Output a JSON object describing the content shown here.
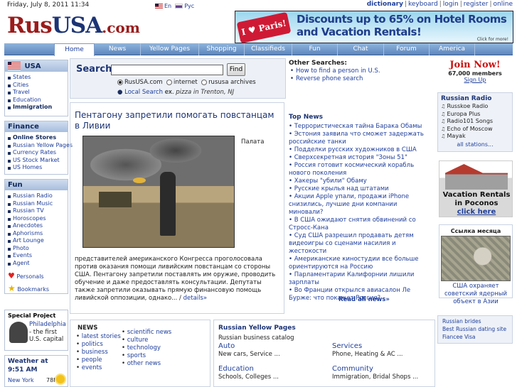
{
  "header": {
    "date": "Friday, July 8, 2011 11:34",
    "lang_en": "En",
    "lang_ru": "Рус",
    "links": [
      "dictionary",
      "keyboard",
      "login",
      "register",
      "online"
    ]
  },
  "logo": {
    "rus": "Rus",
    "usa": "USA",
    "com": ".com"
  },
  "banner": {
    "badge": "I ♥ Paris!",
    "text": "Discounts up to 65% on Hotel Rooms and Vacation Rentals!",
    "sub": "Click for more!"
  },
  "nav": {
    "tabs": [
      "Home",
      "News",
      "Yellow Pages",
      "Shopping",
      "Classifieds",
      "Fun",
      "Chat",
      "Forum",
      "America"
    ]
  },
  "sidebar": {
    "usa_title": "USA",
    "usa_items": [
      "States",
      "Cities",
      "Travel",
      "Education",
      "Immigration"
    ],
    "finance_title": "Finance",
    "finance_items": [
      "Online Stores",
      "Russian Yellow Pages",
      "Currency Rates",
      "US Stock Market",
      "US Homes"
    ],
    "fun_title": "Fun",
    "fun_items": [
      "Russian Radio",
      "Russian Music",
      "Russian TV",
      "Horoscopes",
      "Anecdotes",
      "Aphorisms",
      "Art Lounge",
      "Photo",
      "Events",
      "Agent"
    ],
    "personals": "Personals",
    "bookmarks": "Bookmarks"
  },
  "search": {
    "label": "Search:",
    "button": "Find",
    "value": "",
    "options": [
      "RusUSA.com",
      "internet",
      "rususa archives"
    ],
    "local_link": "Local Search",
    "local_ex": "ex.",
    "local_example": "pizza in Trenton, NJ"
  },
  "other_searches": {
    "title": "Other Searches:",
    "items": [
      "How to find a person in U.S.",
      "Reverse phone search"
    ]
  },
  "article": {
    "title": "Пентагону запретили помогать повстанцам в Ливии",
    "side_word": "Палата",
    "body": "представителей американского Конгресса проголосовала против оказания помощи ливийским повстанцам со стороны США. Пентагону запретили поставлять им оружие, проводить обучение и даже предоставлять консультации. Депутаты также запретили оказывать прямую финансовую помощь ливийской оппозиции, однако... /",
    "details": "details»"
  },
  "top_news": {
    "title": "Top News",
    "items": [
      "Террористическая тайна Барака Обамы",
      "Эстония заявила что сможет задержать российские танки",
      "Подделки русских художников в США",
      "Сверхсекретная история \"Зоны 51\"",
      "Россия готовит космический корабль нового поколения",
      "Хакеры \"убили\" Обаму",
      "Русские крылья над штатами",
      "Акции Apple упали, продажи iPhone снизились, лучшие дни компании миновали?",
      "В США ожидают снятия обвинений со Стросс-Кана",
      "Суд США разрешил продавать детям видеоигры со сценами насилия и жестокости",
      "Американские киностудии все больше ориентируются на Россию",
      "Парламентарии Калифорнии лишили зарплаты",
      "Во Франции открылся авиасалон Ле Бурже: что покажет Россия?"
    ],
    "read_all": "Read all news»"
  },
  "join": {
    "title": "Join Now!",
    "members": "67,000 members",
    "signup": "Sign Up"
  },
  "radio": {
    "title": "Russian Radio",
    "stations": [
      "Russkoe Radio",
      "Europa Plus",
      "Radio101 Songs",
      "Echo of Moscow",
      "Mayak"
    ],
    "all": "all stations..."
  },
  "vacation": {
    "line1": "Vacation Rentals in Poconos",
    "link": "click here"
  },
  "month": {
    "title": "Ссылка месяца",
    "caption": "США охраняет советский ядерный объект в Азии"
  },
  "brides": [
    "Russian brides",
    "Best Russian dating site",
    "Fiancee Visa"
  ],
  "special": {
    "title": "Special Project",
    "link": "Philadelphia",
    "text1": "- the first",
    "text2": "U.S. capital"
  },
  "weather": {
    "title": "Weather at 9:51 AM",
    "city": "New York",
    "temp": "78F"
  },
  "news_block": {
    "title": "NEWS",
    "col1": [
      "latest stories",
      "politics",
      "business",
      "people",
      "events"
    ],
    "col2": [
      "scientific news",
      "culture",
      "technology",
      "sports",
      "other news"
    ]
  },
  "yellow_pages": {
    "title": "Russian Yellow Pages",
    "subtitle": "Russian business catalog",
    "cats": [
      {
        "name": "Auto",
        "desc": "New cars, Service ..."
      },
      {
        "name": "Services",
        "desc": "Phone, Heating & AC ..."
      },
      {
        "name": "Education",
        "desc": "Schools, Colleges ..."
      },
      {
        "name": "Community",
        "desc": "Immigration, Bridal Shops ..."
      }
    ]
  },
  "colors": {
    "nav_blue": "#5d86bd",
    "link": "#1f3f9c",
    "logo_red": "#9a1b1b",
    "logo_blue": "#1c3475"
  }
}
